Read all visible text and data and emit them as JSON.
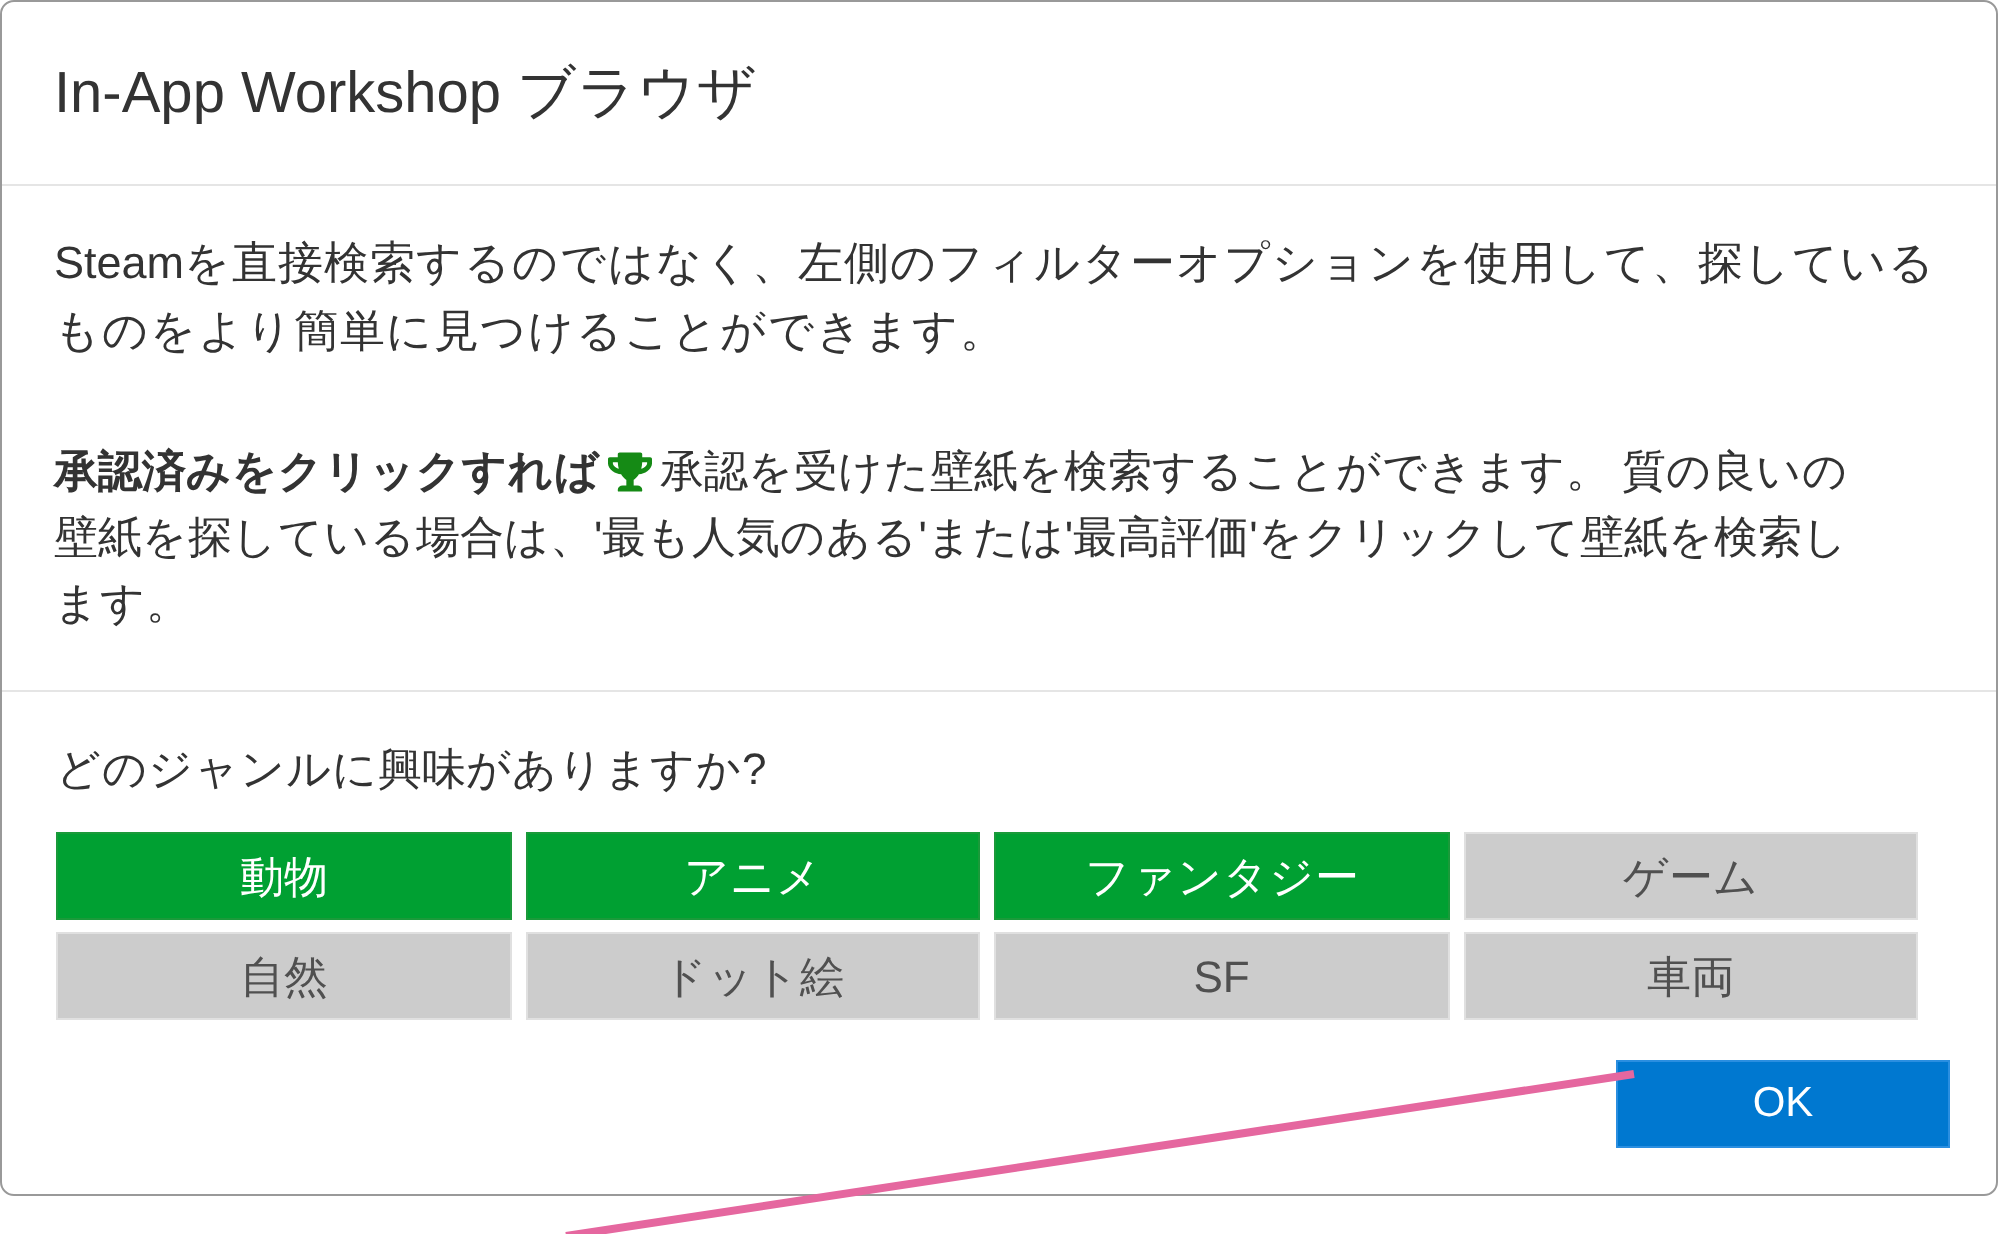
{
  "dialog": {
    "title": "In-App Workshop ブラウザ"
  },
  "intro_text": "Steamを直接検索するのではなく、左側のフィルターオプションを使用して、探しているものをより簡単に見つけることができます。",
  "approved_hint": {
    "lead": "承認済みをクリックすれば",
    "text": "承認を受けた壁紙を検索することができます。 質の良いの壁紙を探している場合は、'最も人気のある'または'最高評価'をクリックして壁紙を検索します。"
  },
  "genre_prompt": "どのジャンルに興味がありますか?",
  "genres": [
    {
      "label": "動物",
      "selected": true
    },
    {
      "label": "アニメ",
      "selected": true
    },
    {
      "label": "ファンタジー",
      "selected": true
    },
    {
      "label": "ゲーム",
      "selected": false
    },
    {
      "label": "自然",
      "selected": false
    },
    {
      "label": "ドット絵",
      "selected": false
    },
    {
      "label": "SF",
      "selected": false
    },
    {
      "label": "車両",
      "selected": false
    }
  ],
  "ok_button": {
    "label": "OK"
  }
}
